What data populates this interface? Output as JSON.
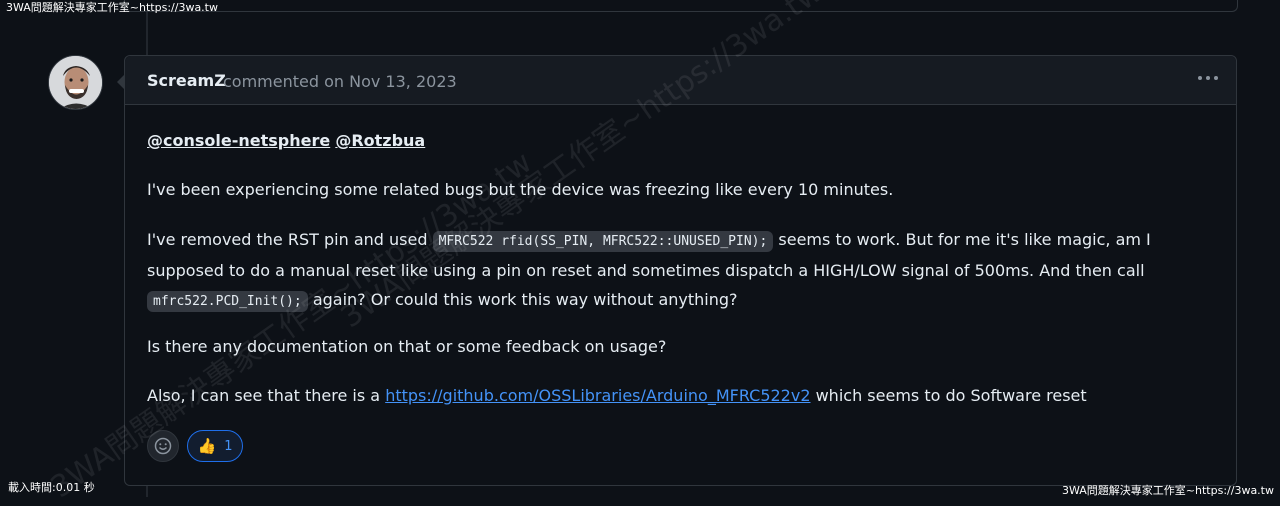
{
  "overlay": {
    "top_banner": "3WA問題解決專家工作室~https://3wa.tw",
    "bottom_left": "載入時間:0.01 秒",
    "bottom_right": "3WA問題解決專家工作室~https://3wa.tw",
    "watermark": "3WA問題解決專家工作室~https://3wa.tw"
  },
  "comment": {
    "author": "ScreamZ",
    "meta": "commented on Nov 13, 2023",
    "menu_icon": "kebab-horizontal-icon",
    "mentions": [
      "@console-netsphere",
      "@Rotzbua"
    ],
    "p1": "I've been experiencing some related bugs but the device was freezing like every 10 minutes.",
    "p2_a": "I've removed the RST pin and used",
    "p2_code1": "MFRC522 rfid(SS_PIN, MFRC522::UNUSED_PIN);",
    "p2_b": "seems to work. But for me it's like magic, am I supposed to do a manual reset like using a pin on reset and sometimes dispatch a HIGH/LOW signal of 500ms. And then call",
    "p2_code2": "mfrc522.PCD_Init();",
    "p2_c": "again? Or could this work this way without anything?",
    "p3": "Is there any documentation on that or some feedback on usage?",
    "p4_a": "Also, I can see that there is a",
    "p4_link": "https://github.com/OSSLibraries/Arduino_MFRC522v2",
    "p4_b": "which seems to do Software reset",
    "reactions": {
      "add_icon": "smiley-icon",
      "thumbs_icon": "thumbs-up-icon",
      "thumbs_count": "1"
    }
  },
  "colors": {
    "background": "#0d1117",
    "header_bg": "#161b22",
    "border": "#30363d",
    "link": "#4493f8"
  }
}
